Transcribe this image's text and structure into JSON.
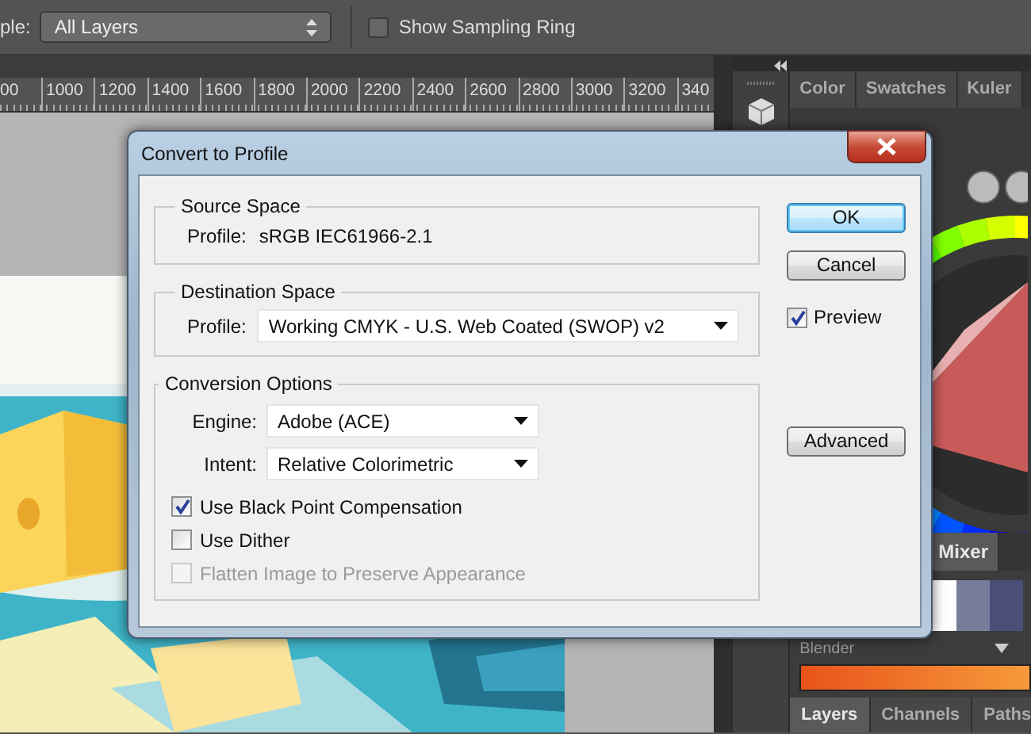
{
  "options_bar": {
    "sample_label": "ple:",
    "sample_value": "All Layers",
    "sampling_ring": {
      "label": "Show Sampling Ring",
      "checked": false
    }
  },
  "ruler": {
    "labels": [
      "00",
      "1000",
      "1200",
      "1400",
      "1600",
      "1800",
      "2000",
      "2200",
      "2400",
      "2600",
      "2800",
      "3000",
      "3200",
      "340"
    ]
  },
  "panels": {
    "color_tabs": [
      {
        "label": "Color",
        "selected": false
      },
      {
        "label": "Swatches",
        "selected": false
      },
      {
        "label": "Kuler",
        "selected": false
      }
    ],
    "mixer_tab": {
      "label": "Mixer",
      "selected": true
    },
    "blender_label": "Blender",
    "bottom_tabs": [
      {
        "label": "Layers",
        "selected": true
      },
      {
        "label": "Channels",
        "selected": false
      },
      {
        "label": "Paths",
        "selected": false
      }
    ]
  },
  "dialog": {
    "title": "Convert to Profile",
    "source_space": {
      "legend": "Source Space",
      "profile_label": "Profile:",
      "profile_value": "sRGB IEC61966-2.1"
    },
    "destination_space": {
      "legend": "Destination Space",
      "profile_label": "Profile:",
      "profile_value": "Working CMYK - U.S. Web Coated (SWOP) v2"
    },
    "conversion_options": {
      "legend": "Conversion Options",
      "engine_label": "Engine:",
      "engine_value": "Adobe (ACE)",
      "intent_label": "Intent:",
      "intent_value": "Relative Colorimetric",
      "options": [
        {
          "label": "Use Black Point Compensation",
          "checked": true,
          "disabled": false
        },
        {
          "label": "Use Dither",
          "checked": false,
          "disabled": false
        },
        {
          "label": "Flatten Image to Preserve Appearance",
          "checked": false,
          "disabled": true
        }
      ]
    },
    "buttons": [
      {
        "label": "OK",
        "default": true
      },
      {
        "label": "Cancel",
        "default": false
      }
    ],
    "preview": {
      "label": "Preview",
      "checked": true
    },
    "advanced_button": {
      "label": "Advanced",
      "default": false
    }
  }
}
